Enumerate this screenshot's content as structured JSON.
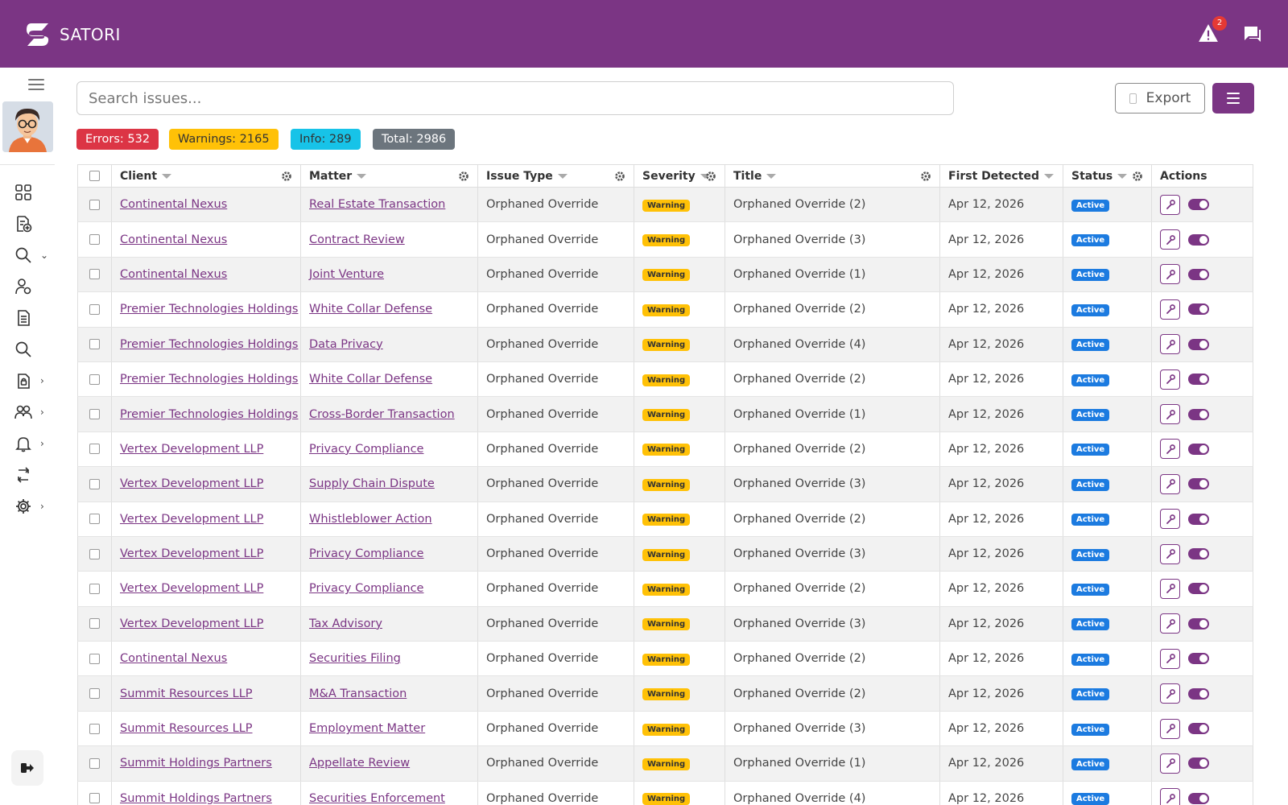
{
  "header": {
    "brand": "SATORI",
    "alert_count": "2"
  },
  "search": {
    "placeholder": "Search issues..."
  },
  "toolbar": {
    "export_label": "Export"
  },
  "stats": {
    "errors": "Errors: 532",
    "warnings": "Warnings: 2165",
    "info": "Info: 289",
    "total": "Total: 2986"
  },
  "table": {
    "columns": {
      "client": "Client",
      "matter": "Matter",
      "issue_type": "Issue Type",
      "severity": "Severity",
      "title": "Title",
      "first_detected": "First Detected",
      "status": "Status",
      "actions": "Actions"
    },
    "rows": [
      {
        "client": "Continental Nexus",
        "matter": "Real Estate Transaction",
        "issue_type": "Orphaned Override",
        "severity": "Warning",
        "title": "Orphaned Override (2)",
        "first_detected": "Apr 12, 2026",
        "status": "Active"
      },
      {
        "client": "Continental Nexus",
        "matter": "Contract Review",
        "issue_type": "Orphaned Override",
        "severity": "Warning",
        "title": "Orphaned Override (3)",
        "first_detected": "Apr 12, 2026",
        "status": "Active"
      },
      {
        "client": "Continental Nexus",
        "matter": "Joint Venture",
        "issue_type": "Orphaned Override",
        "severity": "Warning",
        "title": "Orphaned Override (1)",
        "first_detected": "Apr 12, 2026",
        "status": "Active"
      },
      {
        "client": "Premier Technologies Holdings",
        "matter": "White Collar Defense",
        "issue_type": "Orphaned Override",
        "severity": "Warning",
        "title": "Orphaned Override (2)",
        "first_detected": "Apr 12, 2026",
        "status": "Active"
      },
      {
        "client": "Premier Technologies Holdings",
        "matter": "Data Privacy",
        "issue_type": "Orphaned Override",
        "severity": "Warning",
        "title": "Orphaned Override (4)",
        "first_detected": "Apr 12, 2026",
        "status": "Active"
      },
      {
        "client": "Premier Technologies Holdings",
        "matter": "White Collar Defense",
        "issue_type": "Orphaned Override",
        "severity": "Warning",
        "title": "Orphaned Override (2)",
        "first_detected": "Apr 12, 2026",
        "status": "Active"
      },
      {
        "client": "Premier Technologies Holdings",
        "matter": "Cross-Border Transaction",
        "issue_type": "Orphaned Override",
        "severity": "Warning",
        "title": "Orphaned Override (1)",
        "first_detected": "Apr 12, 2026",
        "status": "Active"
      },
      {
        "client": "Vertex Development LLP",
        "matter": "Privacy Compliance",
        "issue_type": "Orphaned Override",
        "severity": "Warning",
        "title": "Orphaned Override (2)",
        "first_detected": "Apr 12, 2026",
        "status": "Active"
      },
      {
        "client": "Vertex Development LLP",
        "matter": "Supply Chain Dispute",
        "issue_type": "Orphaned Override",
        "severity": "Warning",
        "title": "Orphaned Override (3)",
        "first_detected": "Apr 12, 2026",
        "status": "Active"
      },
      {
        "client": "Vertex Development LLP",
        "matter": "Whistleblower Action",
        "issue_type": "Orphaned Override",
        "severity": "Warning",
        "title": "Orphaned Override (2)",
        "first_detected": "Apr 12, 2026",
        "status": "Active"
      },
      {
        "client": "Vertex Development LLP",
        "matter": "Privacy Compliance",
        "issue_type": "Orphaned Override",
        "severity": "Warning",
        "title": "Orphaned Override (3)",
        "first_detected": "Apr 12, 2026",
        "status": "Active"
      },
      {
        "client": "Vertex Development LLP",
        "matter": "Privacy Compliance",
        "issue_type": "Orphaned Override",
        "severity": "Warning",
        "title": "Orphaned Override (2)",
        "first_detected": "Apr 12, 2026",
        "status": "Active"
      },
      {
        "client": "Vertex Development LLP",
        "matter": "Tax Advisory",
        "issue_type": "Orphaned Override",
        "severity": "Warning",
        "title": "Orphaned Override (3)",
        "first_detected": "Apr 12, 2026",
        "status": "Active"
      },
      {
        "client": "Continental Nexus",
        "matter": "Securities Filing",
        "issue_type": "Orphaned Override",
        "severity": "Warning",
        "title": "Orphaned Override (2)",
        "first_detected": "Apr 12, 2026",
        "status": "Active"
      },
      {
        "client": "Summit Resources LLP",
        "matter": "M&A Transaction",
        "issue_type": "Orphaned Override",
        "severity": "Warning",
        "title": "Orphaned Override (2)",
        "first_detected": "Apr 12, 2026",
        "status": "Active"
      },
      {
        "client": "Summit Resources LLP",
        "matter": "Employment Matter",
        "issue_type": "Orphaned Override",
        "severity": "Warning",
        "title": "Orphaned Override (3)",
        "first_detected": "Apr 12, 2026",
        "status": "Active"
      },
      {
        "client": "Summit Holdings Partners",
        "matter": "Appellate Review",
        "issue_type": "Orphaned Override",
        "severity": "Warning",
        "title": "Orphaned Override (1)",
        "first_detected": "Apr 12, 2026",
        "status": "Active"
      },
      {
        "client": "Summit Holdings Partners",
        "matter": "Securities Enforcement",
        "issue_type": "Orphaned Override",
        "severity": "Warning",
        "title": "Orphaned Override (4)",
        "first_detected": "Apr 12, 2026",
        "status": "Active"
      }
    ]
  },
  "colors": {
    "brand": "#7b3584",
    "error": "#dc3545",
    "warning": "#ffc107",
    "info": "#17c3e8",
    "total": "#6c757d",
    "status_active": "#1c7be0"
  },
  "icons": {
    "header": [
      "alert-triangle-icon",
      "chat-icon"
    ],
    "sidebar": [
      "dashboard-grid-icon",
      "document-add-icon",
      "search-icon",
      "user-settings-icon",
      "document-list-icon",
      "search-icon",
      "file-lock-icon",
      "users-icon",
      "bell-icon",
      "sync-icon",
      "gear-icon",
      "logout-icon"
    ],
    "row_actions": [
      "wrench-icon",
      "toggle-switch"
    ]
  }
}
